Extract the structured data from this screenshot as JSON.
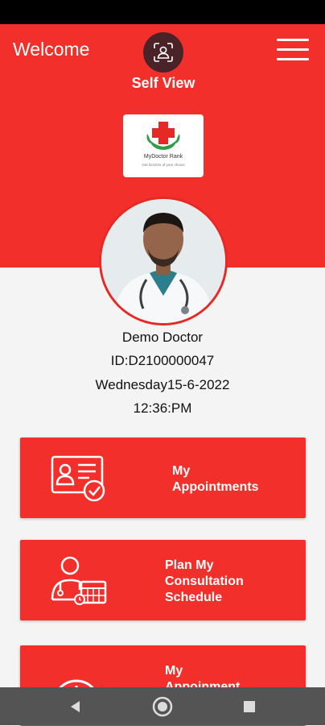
{
  "header": {
    "welcome_text": "Welcome",
    "self_view_label": "Self View",
    "self_view_icon": "face-scan-icon",
    "menu_icon": "hamburger-menu-icon"
  },
  "logo": {
    "name": "MyDoctor Rank",
    "tagline": "Get Doctors of your choice"
  },
  "profile": {
    "name": "Demo Doctor",
    "id": "ID:D2100000047",
    "date": "Wednesday15-6-2022",
    "time": "12:36:PM"
  },
  "menu_cards": [
    {
      "label": "My\nAppointments",
      "icon": "appointment-card-icon"
    },
    {
      "label": "Plan My\nConsultation\nSchedule",
      "icon": "doctor-schedule-icon"
    },
    {
      "label": "My\nAppoinment",
      "icon": "clock-icon"
    }
  ],
  "nav": {
    "back_icon": "back-icon",
    "home_icon": "home-icon",
    "recents_icon": "recents-icon"
  },
  "colors": {
    "brand_red": "#f22f2a",
    "status_bar": "#000000",
    "nav_bar": "#545454"
  }
}
